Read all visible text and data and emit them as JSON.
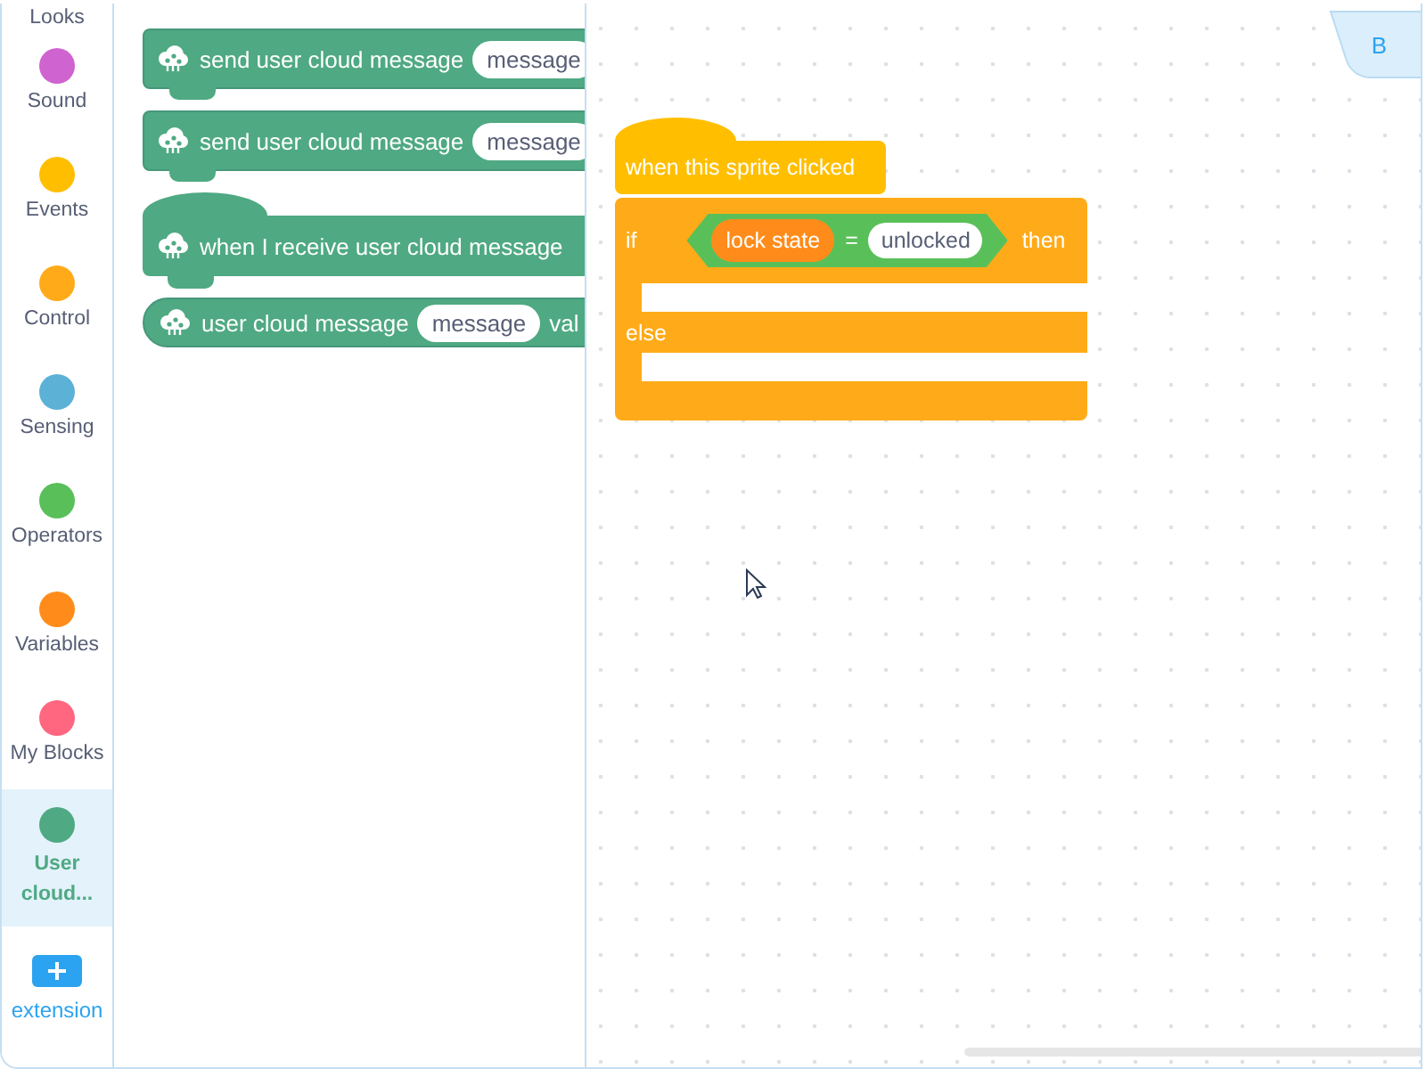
{
  "categories": [
    {
      "label": "Looks",
      "selected": false
    },
    {
      "label": "Sound",
      "color": "#cf63cf",
      "selected": false
    },
    {
      "label": "Events",
      "color": "#ffbf00",
      "selected": false
    },
    {
      "label": "Control",
      "color": "#ffab19",
      "selected": false
    },
    {
      "label": "Sensing",
      "color": "#5cb1d6",
      "selected": false
    },
    {
      "label": "Operators",
      "color": "#59c059",
      "selected": false
    },
    {
      "label": "Variables",
      "color": "#ff8c1a",
      "selected": false
    },
    {
      "label": "My Blocks",
      "color": "#ff6680",
      "selected": false
    },
    {
      "label": "User cloud...",
      "color": "#4fa983",
      "selected": true
    }
  ],
  "extension": {
    "label": "extension"
  },
  "palette": {
    "blocks": [
      {
        "kind": "command",
        "text": "send user cloud message",
        "input": "message"
      },
      {
        "kind": "command",
        "text": "send user cloud message",
        "input": "message"
      },
      {
        "kind": "hat",
        "text": "when I receive user cloud message"
      },
      {
        "kind": "reporter",
        "text": "user cloud message",
        "input": "message",
        "suffix": "val"
      }
    ]
  },
  "workspace": {
    "tab": "B",
    "script": {
      "hat": "when this sprite clicked",
      "if_label": "if",
      "condition": {
        "left": "lock state",
        "operator": "=",
        "right": "unlocked"
      },
      "then_label": "then",
      "else_label": "else"
    }
  }
}
